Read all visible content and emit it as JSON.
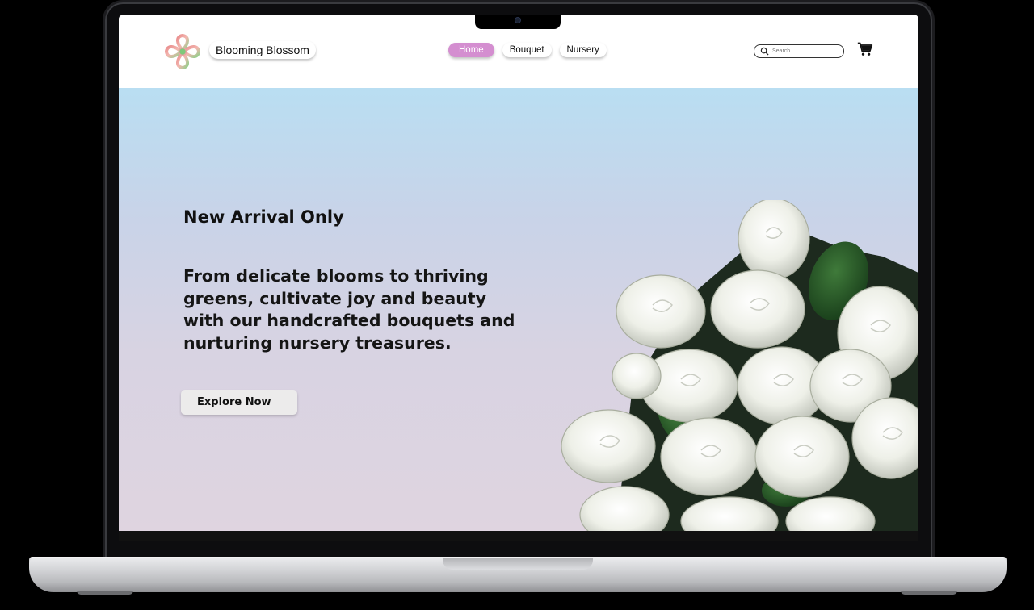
{
  "site": {
    "brand_name": "Blooming Blossom",
    "logo_icon": "four-petal-flower-logo-icon",
    "colors": {
      "accent": "#d48ed0",
      "hero_top": "#b9def2",
      "hero_bottom": "#dfd4e0",
      "button_bg": "#ecebeb"
    }
  },
  "nav": {
    "items": [
      {
        "label": "Home",
        "active": true
      },
      {
        "label": "Bouquet",
        "active": false
      },
      {
        "label": "Nursery",
        "active": false
      }
    ]
  },
  "search": {
    "placeholder": "Search",
    "value": "",
    "icon": "search-icon"
  },
  "cart": {
    "icon": "shopping-cart-icon"
  },
  "hero": {
    "eyebrow": "New Arrival Only",
    "headline": "From delicate blooms to thriving greens, cultivate joy and beauty with our handcrafted bouquets and nurturing nursery treasures.",
    "cta_label": "Explore Now",
    "image": "white-roses-bouquet-image"
  }
}
